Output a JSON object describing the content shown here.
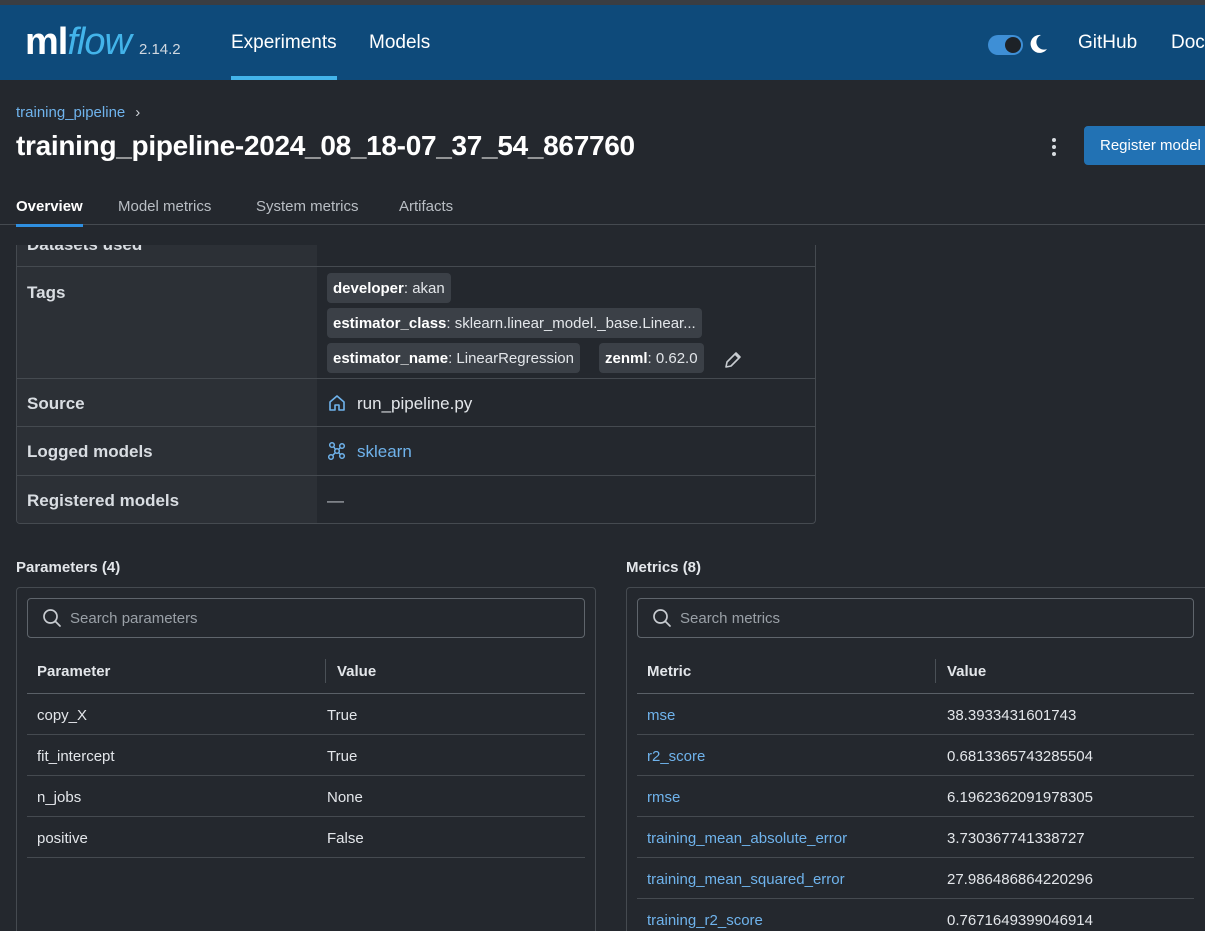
{
  "header": {
    "logo_ml": "ml",
    "logo_flow": "flow",
    "version": "2.14.2",
    "nav": [
      "Experiments",
      "Models"
    ],
    "links": [
      "GitHub",
      "Docs"
    ],
    "dark_mode": true
  },
  "breadcrumb": {
    "parent": "training_pipeline"
  },
  "run": {
    "title": "training_pipeline-2024_08_18-07_37_54_867760",
    "register_label": "Register model"
  },
  "tabs": [
    "Overview",
    "Model metrics",
    "System metrics",
    "Artifacts"
  ],
  "details": {
    "datasets_label": "Datasets used",
    "tags_label": "Tags",
    "tags": [
      {
        "key": "developer",
        "value": ": akan"
      },
      {
        "key": "estimator_class",
        "value": ": sklearn.linear_model._base.Linear..."
      },
      {
        "key": "estimator_name",
        "value": ": LinearRegression"
      },
      {
        "key": "zenml",
        "value": ": 0.62.0"
      }
    ],
    "source_label": "Source",
    "source_value": "run_pipeline.py",
    "logged_models_label": "Logged models",
    "logged_models_value": "sklearn",
    "registered_models_label": "Registered models",
    "registered_models_value": "—"
  },
  "parameters": {
    "title": "Parameters (4)",
    "search_placeholder": "Search parameters",
    "col_key": "Parameter",
    "col_value": "Value",
    "rows": [
      {
        "key": "copy_X",
        "value": "True"
      },
      {
        "key": "fit_intercept",
        "value": "True"
      },
      {
        "key": "n_jobs",
        "value": "None"
      },
      {
        "key": "positive",
        "value": "False"
      }
    ]
  },
  "metrics": {
    "title": "Metrics (8)",
    "search_placeholder": "Search metrics",
    "col_key": "Metric",
    "col_value": "Value",
    "rows": [
      {
        "key": "mse",
        "value": "38.3933431601743"
      },
      {
        "key": "r2_score",
        "value": "0.6813365743285504"
      },
      {
        "key": "rmse",
        "value": "6.1962362091978305"
      },
      {
        "key": "training_mean_absolute_error",
        "value": "3.730367741338727"
      },
      {
        "key": "training_mean_squared_error",
        "value": "27.986486864220296"
      },
      {
        "key": "training_r2_score",
        "value": "0.7671649399046914"
      }
    ]
  },
  "colors": {
    "header_bg": "#0e4a7a",
    "accent": "#43b4ea",
    "link": "#6fb3ec",
    "primary_button": "#2272b4"
  }
}
